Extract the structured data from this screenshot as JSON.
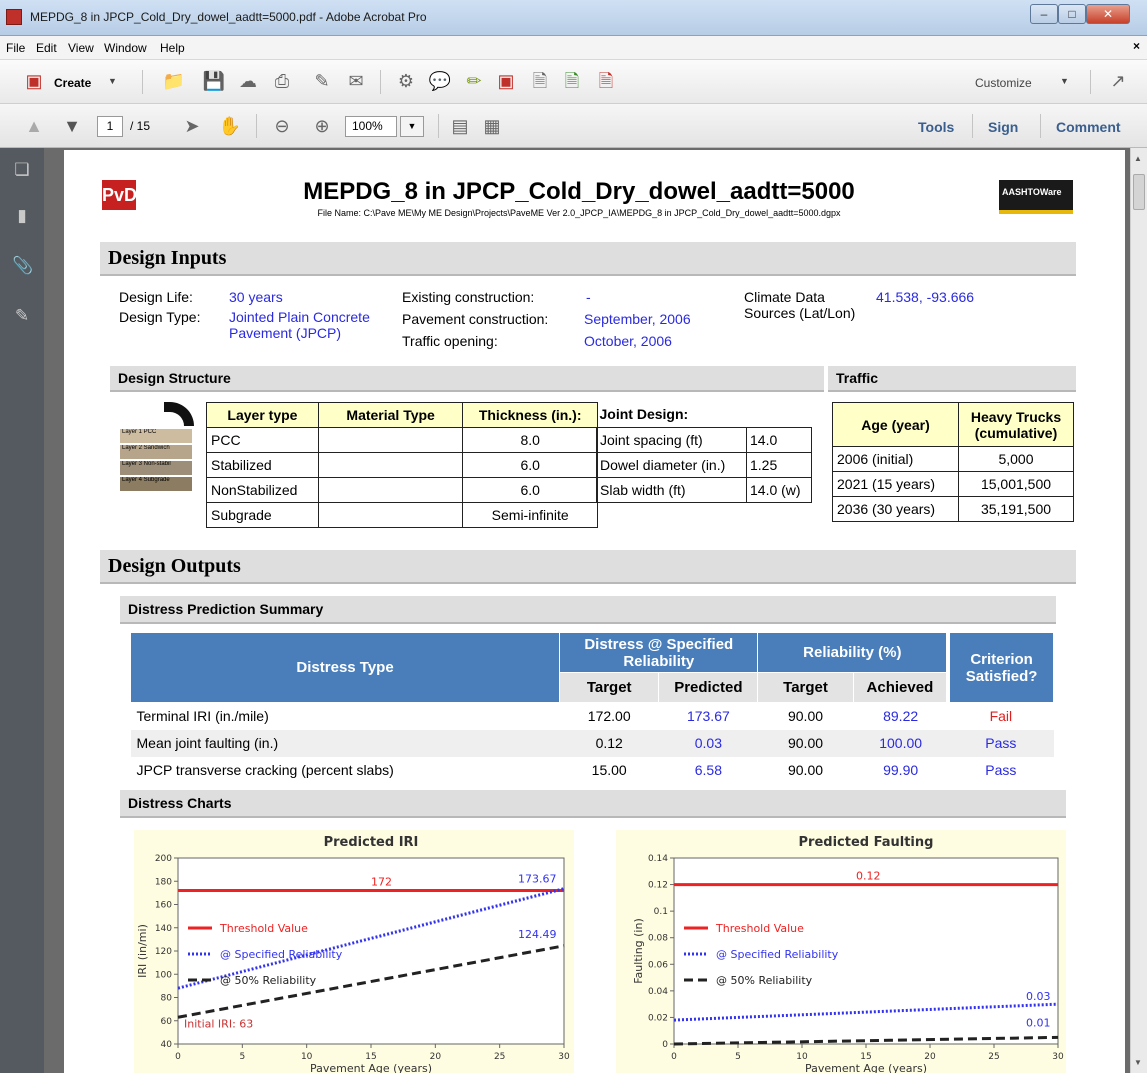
{
  "window": {
    "title": "MEPDG_8 in JPCP_Cold_Dry_dowel_aadtt=5000.pdf - Adobe Acrobat Pro"
  },
  "menu": [
    "File",
    "Edit",
    "View",
    "Window",
    "Help"
  ],
  "toolbar": {
    "create_label": "Create",
    "customize_label": "Customize"
  },
  "nav": {
    "page_current": "1",
    "page_total": "/ 15",
    "zoom": "100%",
    "tools": "Tools",
    "sign": "Sign",
    "comment": "Comment"
  },
  "report": {
    "logo_text": "PvD",
    "title": "MEPDG_8 in JPCP_Cold_Dry_dowel_aadtt=5000",
    "file_name": "File Name: C:\\Pave ME\\My ME Design\\Projects\\PaveME Ver 2.0_JPCP_IA\\MEPDG_8 in JPCP_Cold_Dry_dowel_aadtt=5000.dgpx",
    "aashto_text": "AASHTOWare"
  },
  "inputs": {
    "heading": "Design Inputs",
    "design_life_label": "Design Life:",
    "design_life": "30 years",
    "design_type_label": "Design Type:",
    "design_type_l1": "Jointed Plain Concrete",
    "design_type_l2": "Pavement (JPCP)",
    "existing_label": "Existing construction:",
    "existing": "-",
    "pavement_label": "Pavement construction:",
    "pavement": "September, 2006",
    "traffic_label": "Traffic opening:",
    "traffic": "October, 2006",
    "climate_label_l1": "Climate Data",
    "climate_label_l2": "Sources (Lat/Lon)",
    "climate": "41.538, -93.666"
  },
  "structure": {
    "heading": "Design Structure",
    "thumb_layers": [
      "Layer 1 PCC",
      "Layer 2 Sandwich",
      "Layer 3 Non-stabil",
      "Layer 4 Subgrade"
    ],
    "headers": [
      "Layer type",
      "Material Type",
      "Thickness (in.):"
    ],
    "rows": [
      [
        "PCC",
        "",
        "8.0"
      ],
      [
        "Stabilized",
        "",
        "6.0"
      ],
      [
        "NonStabilized",
        "",
        "6.0"
      ],
      [
        "Subgrade",
        "",
        "Semi-infinite"
      ]
    ],
    "joint_heading": "Joint Design:",
    "joint_rows": [
      [
        "Joint spacing (ft)",
        "14.0"
      ],
      [
        "Dowel diameter (in.)",
        "1.25"
      ],
      [
        "Slab width (ft)",
        "14.0 (w)"
      ]
    ]
  },
  "traffic": {
    "heading": "Traffic",
    "headers": [
      "Age (year)",
      "Heavy Trucks (cumulative)"
    ],
    "rows": [
      [
        "2006 (initial)",
        "5,000"
      ],
      [
        "2021 (15 years)",
        "15,001,500"
      ],
      [
        "2036 (30 years)",
        "35,191,500"
      ]
    ]
  },
  "outputs": {
    "heading": "Design Outputs",
    "summary_heading": "Distress Prediction Summary",
    "col_distress_type": "Distress Type",
    "col_group_distress": "Distress @ Specified Reliability",
    "col_group_reliability": "Reliability (%)",
    "col_criterion": "Criterion Satisfied?",
    "col_target": "Target",
    "col_predicted": "Predicted",
    "col_target2": "Target",
    "col_achieved": "Achieved",
    "rows": [
      {
        "type": "Terminal IRI (in./mile)",
        "target": "172.00",
        "predicted": "173.67",
        "rel_target": "90.00",
        "achieved": "89.22",
        "criterion": "Fail"
      },
      {
        "type": "Mean joint faulting (in.)",
        "target": "0.12",
        "predicted": "0.03",
        "rel_target": "90.00",
        "achieved": "100.00",
        "criterion": "Pass"
      },
      {
        "type": "JPCP transverse cracking (percent slabs)",
        "target": "15.00",
        "predicted": "6.58",
        "rel_target": "90.00",
        "achieved": "99.90",
        "criterion": "Pass"
      }
    ],
    "charts_heading": "Distress Charts"
  },
  "colors": {
    "threshold": "#ee2222",
    "specified": "#3333ee",
    "fifty": "#222222",
    "fail": "#e02020",
    "pass": "#2a2ae0",
    "header_blue": "#4a7ebb"
  },
  "chart_data": [
    {
      "type": "line",
      "title": "Predicted IRI",
      "xlabel": "Pavement Age (years)",
      "ylabel": "IRI (in/mi)",
      "xlim": [
        0,
        30
      ],
      "ylim": [
        40,
        200
      ],
      "xticks": [
        "0",
        "5",
        "10",
        "15",
        "20",
        "25",
        "30"
      ],
      "yticks": [
        "40",
        "60",
        "80",
        "100",
        "120",
        "140",
        "160",
        "180",
        "200"
      ],
      "series": [
        {
          "name": "Threshold Value",
          "x": [
            0,
            30
          ],
          "y": [
            172,
            172
          ]
        },
        {
          "name": "@ Specified Reliability",
          "x": [
            0,
            30
          ],
          "y": [
            88,
            173.67
          ]
        },
        {
          "name": "@ 50% Reliability",
          "x": [
            0,
            30
          ],
          "y": [
            63,
            124.49
          ]
        }
      ],
      "annotations": [
        {
          "text": "172",
          "x": 15,
          "y": 172
        },
        {
          "text": "173.67",
          "x": 30,
          "y": 173.67
        },
        {
          "text": "124.49",
          "x": 30,
          "y": 124.49
        },
        {
          "text": "Initial IRI: 63",
          "x": 0,
          "y": 63
        }
      ]
    },
    {
      "type": "line",
      "title": "Predicted Faulting",
      "xlabel": "Pavement Age (years)",
      "ylabel": "Faulting (in)",
      "xlim": [
        0,
        30
      ],
      "ylim": [
        0,
        0.14
      ],
      "xticks": [
        "0",
        "5",
        "10",
        "15",
        "20",
        "25",
        "30"
      ],
      "yticks": [
        "0",
        "0.02",
        "0.04",
        "0.06",
        "0.08",
        "0.1",
        "0.12",
        "0.14"
      ],
      "series": [
        {
          "name": "Threshold Value",
          "x": [
            0,
            30
          ],
          "y": [
            0.12,
            0.12
          ]
        },
        {
          "name": "@ Specified Reliability",
          "x": [
            0,
            30
          ],
          "y": [
            0.018,
            0.03
          ]
        },
        {
          "name": "@ 50% Reliability",
          "x": [
            0,
            30
          ],
          "y": [
            0.0,
            0.005
          ]
        }
      ],
      "annotations": [
        {
          "text": "0.12",
          "x": 15,
          "y": 0.12
        },
        {
          "text": "0.03",
          "x": 30,
          "y": 0.03
        },
        {
          "text": "0.01",
          "x": 30,
          "y": 0.01
        }
      ]
    }
  ]
}
